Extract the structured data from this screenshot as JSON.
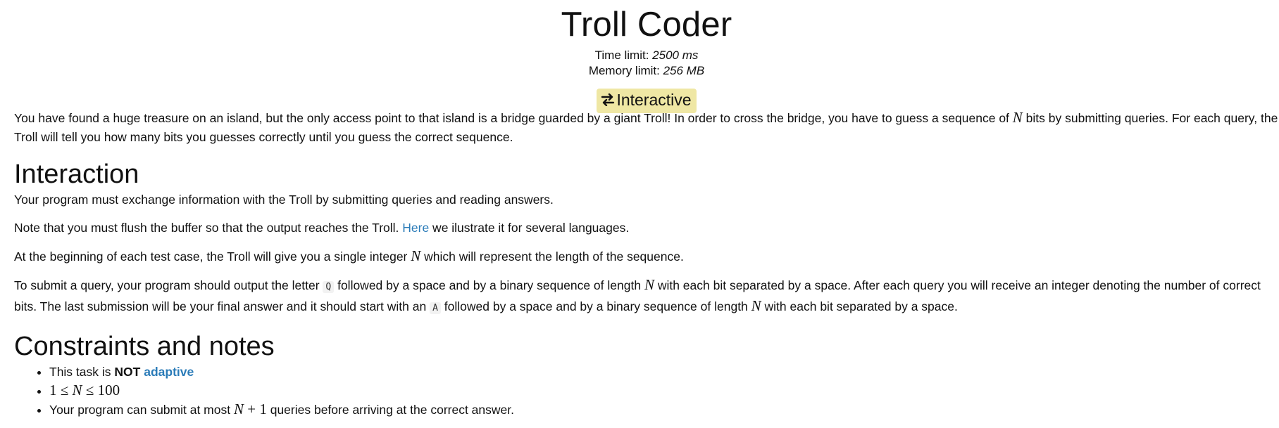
{
  "header": {
    "title": "Troll Coder",
    "time_limit_label": "Time limit: ",
    "time_limit_value": "2500 ms",
    "memory_limit_label": "Memory limit: ",
    "memory_limit_value": "256 MB",
    "badge_label": "Interactive",
    "badge_icon": "swap-arrows-icon",
    "badge_color": "#efe7a4"
  },
  "intro": {
    "part1": "You have found a huge treasure on an island, but the only access point to that island is a bridge guarded by a giant Troll! In order to cross the bridge, you have to guess a sequence of ",
    "var_n": "N",
    "part2": " bits by submitting queries. For each query, the Troll will tell you how many bits you guesses correctly until you guess the correct sequence."
  },
  "interaction": {
    "heading": "Interaction",
    "p1": "Your program must exchange information with the Troll by submitting queries and reading answers.",
    "p2_before": "Note that you must flush the buffer so that the output reaches the Troll. ",
    "p2_link": "Here",
    "p2_after": " we ilustrate it for several languages.",
    "p3_before": "At the beginning of each test case, the Troll will give you a single integer ",
    "p3_var": "N",
    "p3_after": " which will represent the length of the sequence.",
    "p4_a": "To submit a query, your program should output the letter ",
    "p4_code_q": "Q",
    "p4_b": " followed by a space and by a binary sequence of length ",
    "p4_var1": "N",
    "p4_c": " with each bit separated by a space. After each query you will receive an integer denoting the number of correct bits. The last submission will be your final answer and it should start with an ",
    "p4_code_a": "A",
    "p4_d": " followed by a space and by a binary sequence of length ",
    "p4_var2": "N",
    "p4_e": " with each bit separated by a space."
  },
  "constraints": {
    "heading": "Constraints and notes",
    "item1_before": "This task is ",
    "item1_bold": "NOT",
    "item1_link": "adaptive",
    "item2_one": "1",
    "item2_leq1": "≤",
    "item2_n": "N",
    "item2_leq2": "≤",
    "item2_hundred": "100",
    "item3_before": "Your program can submit at most ",
    "item3_n": "N",
    "item3_plus": "+",
    "item3_one": "1",
    "item3_after": " queries before arriving at the correct answer."
  },
  "colors": {
    "link": "#2a7bb8",
    "badge": "#efe7a4",
    "text": "#111111"
  }
}
